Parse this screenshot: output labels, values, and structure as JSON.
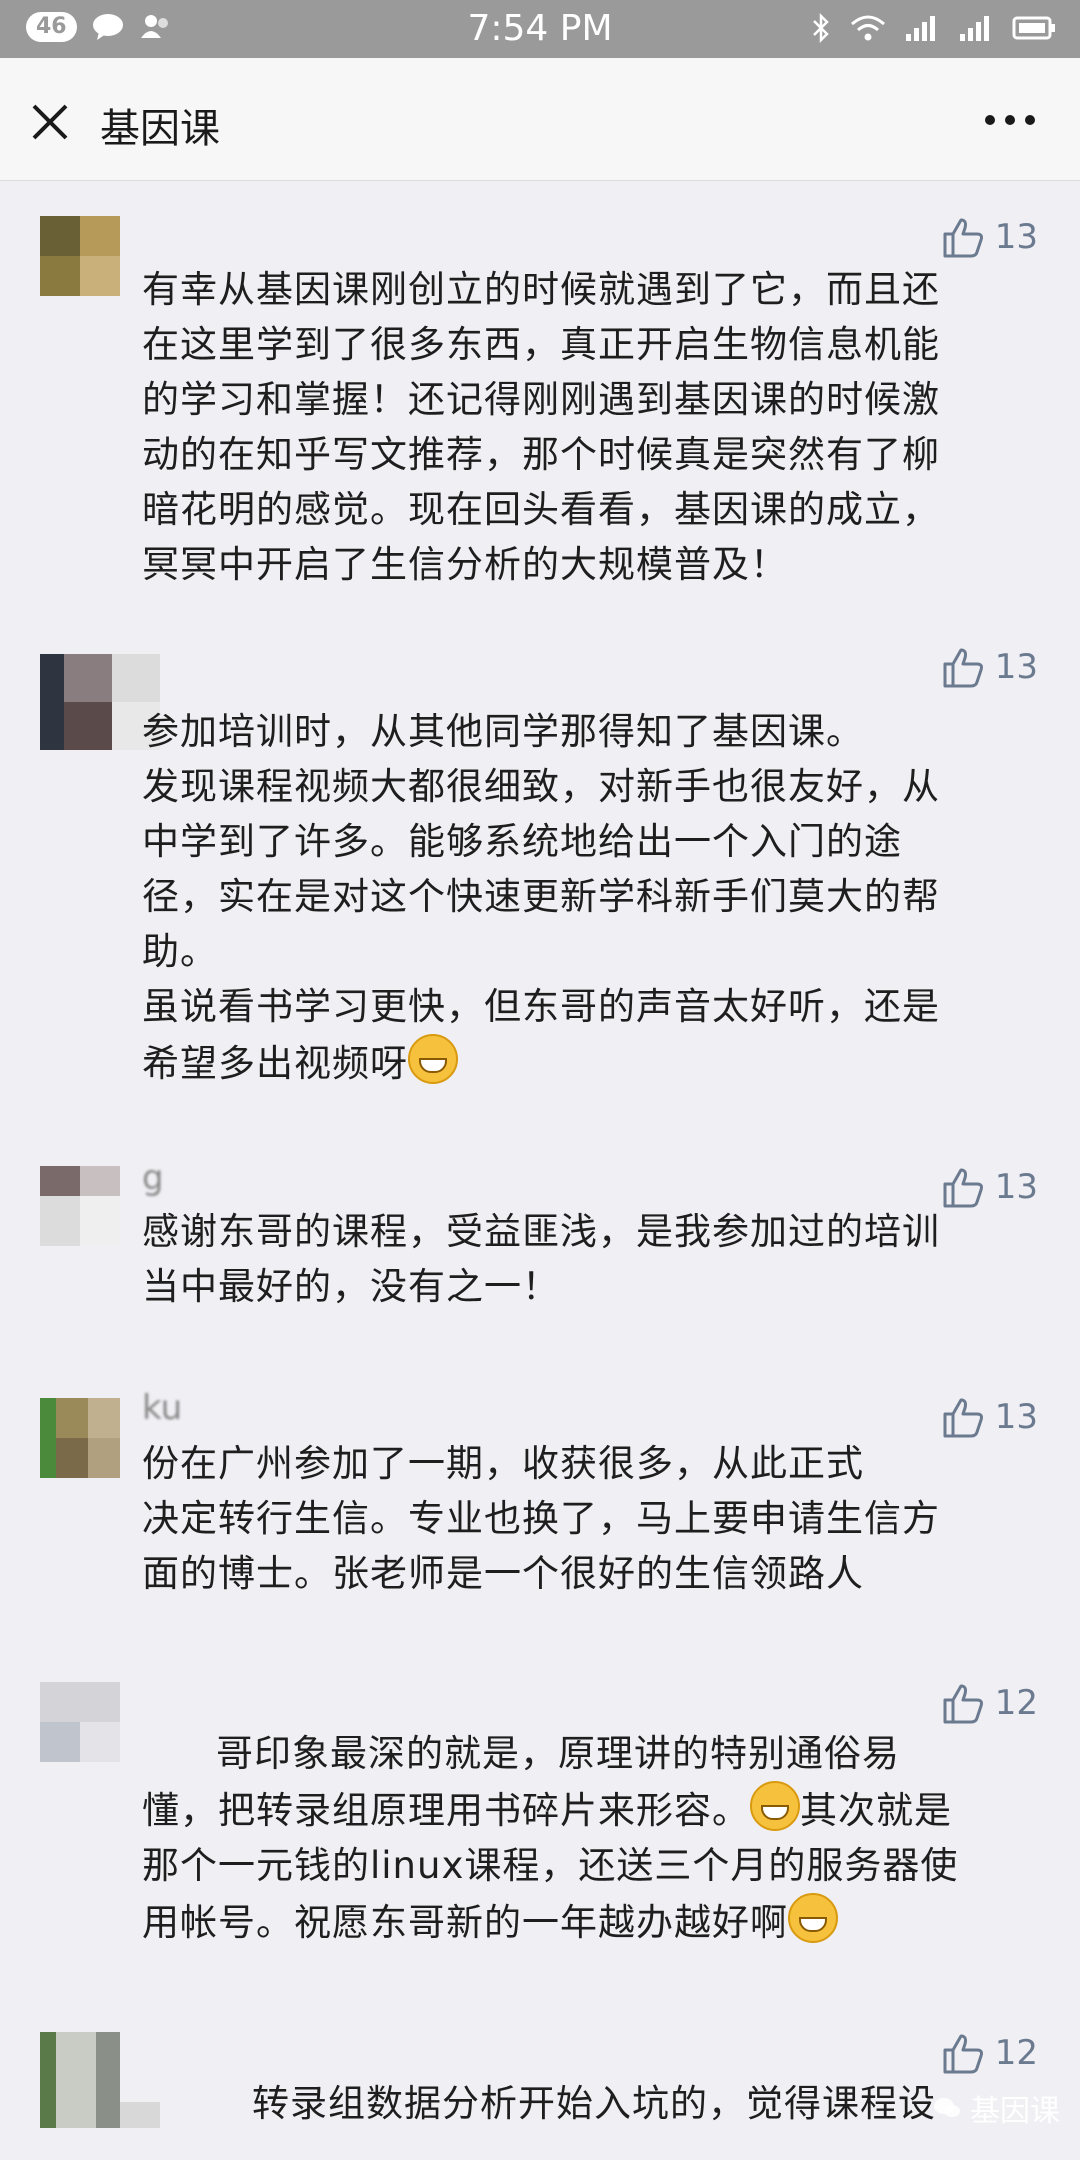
{
  "status_bar": {
    "time": "7:54 PM",
    "badge": "46",
    "icons": [
      "chat-icon",
      "contacts-icon",
      "bluetooth-icon",
      "wifi-icon",
      "signal-icon",
      "battery-icon"
    ]
  },
  "nav": {
    "title": "基因课",
    "close_icon": "close-icon",
    "more_icon": "more-icon"
  },
  "comments": [
    {
      "name": "",
      "likes": "13",
      "text": "有幸从基因课刚创立的时候就遇到了它，而且还\n在这里学到了很多东西，真正开启生物信息机能\n的学习和掌握！还记得刚刚遇到基因课的时候激\n动的在知乎写文推荐，那个时候真是突然有了柳\n暗花明的感觉。现在回头看看，基因课的成立，\n冥冥中开启了生信分析的大规模普及！"
    },
    {
      "name": "",
      "likes": "13",
      "text": "参加培训时，从其他同学那得知了基因课。\n发现课程视频大都很细致，对新手也很友好，从\n中学到了许多。能够系统地给出一个入门的途\n径，实在是对这个快速更新学科新手们莫大的帮\n助。\n虽说看书学习更快，但东哥的声音太好听，还是\n希望多出视频呀"
    },
    {
      "name": "g",
      "likes": "13",
      "text": "感谢东哥的课程，受益匪浅，是我参加过的培训\n当中最好的，没有之一！"
    },
    {
      "name": "ku",
      "likes": "13",
      "text": "份在广州参加了一期，收获很多，从此正式\n决定转行生信。专业也换了，马上要申请生信方\n面的博士。张老师是一个很好的生信领路人"
    },
    {
      "name": "",
      "likes": "12",
      "text_lines": [
        "哥印象最深的就是，原理讲的特别通俗易",
        "懂，把转录组原理用书碎片来形容。",
        "其次就是",
        "那个一元钱的linux课程，还送三个月的服务器使",
        "用帐号。祝愿东哥新的一年越办越好啊"
      ]
    },
    {
      "name": "",
      "likes": "12",
      "text": "转录组数据分析开始入坑的，觉得课程设"
    }
  ],
  "watermark": "基因课",
  "colors": {
    "status_bar": "#9a9a9a",
    "nav_bg": "#f7f7f7",
    "page_bg": "#efeff4",
    "like_color": "#6b7a8f"
  }
}
